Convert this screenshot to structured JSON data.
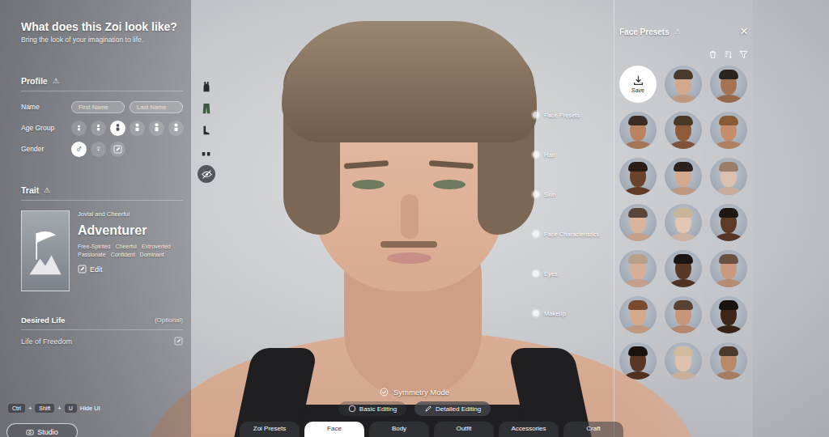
{
  "header": {
    "title": "What does this Zoi look like?",
    "subtitle": "Bring the look of your imagination to life."
  },
  "profile": {
    "title": "Profile",
    "warning": "⚠",
    "name_label": "Name",
    "first_name_placeholder": "First Name",
    "last_name_placeholder": "Last Name",
    "age_label": "Age Group",
    "age_groups": [
      {
        "kind": "infant",
        "selected": false
      },
      {
        "kind": "child",
        "selected": false
      },
      {
        "kind": "teen",
        "selected": true
      },
      {
        "kind": "young",
        "selected": false
      },
      {
        "kind": "adult",
        "selected": false
      },
      {
        "kind": "elder",
        "selected": false
      }
    ],
    "gender_label": "Gender",
    "genders": [
      {
        "kind": "symbol",
        "symbol": "♂",
        "selected": true
      },
      {
        "kind": "symbol",
        "symbol": "♀",
        "selected": false
      },
      {
        "kind": "edit",
        "selected": false
      }
    ]
  },
  "trait": {
    "title": "Trait",
    "warning": "⚠",
    "subtitle": "Jovial and Cheerful",
    "name": "Adventurer",
    "tags": [
      "Free-Spirited",
      "Cheerful",
      "Extroverted",
      "Passionate",
      "Confident",
      "Dominant"
    ],
    "edit": "Edit"
  },
  "desired_life": {
    "title": "Desired Life",
    "optional": "(Optional)",
    "value": "Life of Freedom"
  },
  "outfit_slots": [
    {
      "kind": "top"
    },
    {
      "kind": "bottom"
    },
    {
      "kind": "shoes"
    },
    {
      "kind": "feet"
    },
    {
      "kind": "hide"
    }
  ],
  "categories": [
    {
      "label": "Face Presets",
      "selected": false
    },
    {
      "label": "Hair",
      "selected": false
    },
    {
      "label": "Skin",
      "selected": false
    },
    {
      "label": "Face Characteristics",
      "selected": false
    },
    {
      "label": "Eyes",
      "selected": false
    },
    {
      "label": "Makeup",
      "selected": false
    }
  ],
  "presets_panel": {
    "title": "Face Presets",
    "warning": "⚠",
    "close": "×",
    "save": "Save",
    "faces": [
      {
        "color": "#d2a98c",
        "hair": "#4a3a2e"
      },
      {
        "color": "#a77453",
        "hair": "#2a2420"
      },
      {
        "color": "#b98260",
        "hair": "#3b2d24"
      },
      {
        "color": "#8e5b3d",
        "hair": "#4a3826"
      },
      {
        "color": "#c48e6c",
        "hair": "#8a5a34"
      },
      {
        "color": "#6b432b",
        "hair": "#2a1d16"
      },
      {
        "color": "#d3aa8f",
        "hair": "#2b2220"
      },
      {
        "color": "#dcc0b0",
        "hair": "#9a7e6a"
      },
      {
        "color": "#dab39a",
        "hair": "#5a4538"
      },
      {
        "color": "#e2c7b5",
        "hair": "#c9b69a"
      },
      {
        "color": "#5e3b27",
        "hair": "#1f1712"
      },
      {
        "color": "#d8b09a",
        "hair": "#b9a089"
      },
      {
        "color": "#5a3826",
        "hair": "#1c1410"
      },
      {
        "color": "#c99a7e",
        "hair": "#6b5240"
      },
      {
        "color": "#d6a98b",
        "hair": "#7a4a2c"
      },
      {
        "color": "#c8977a",
        "hair": "#5a4232"
      },
      {
        "color": "#3e2618",
        "hair": "#1a120d"
      },
      {
        "color": "#5a3624",
        "hair": "#1a120c"
      },
      {
        "color": "#e0c2ac",
        "hair": "#d1bd9e"
      },
      {
        "color": "#b88a6a",
        "hair": "#4b3a2c"
      }
    ]
  },
  "symmetry": {
    "label": "Symmetry Mode",
    "checked": true
  },
  "edit_modes": [
    {
      "label": "Basic Editing",
      "selected": false
    },
    {
      "label": "Detailed Editing",
      "selected": true
    }
  ],
  "tabs": [
    {
      "label": "Zoi Presets",
      "selected": false
    },
    {
      "label": "Face",
      "selected": true
    },
    {
      "label": "Body",
      "selected": false
    },
    {
      "label": "Outfit",
      "selected": false
    },
    {
      "label": "Accessories",
      "selected": false
    },
    {
      "label": "Craft",
      "selected": false
    }
  ],
  "hint": {
    "keys": [
      "Ctrl",
      "Shift",
      "U"
    ],
    "joiner": "+",
    "label": "Hide UI"
  },
  "studio": {
    "label": "Studio"
  }
}
